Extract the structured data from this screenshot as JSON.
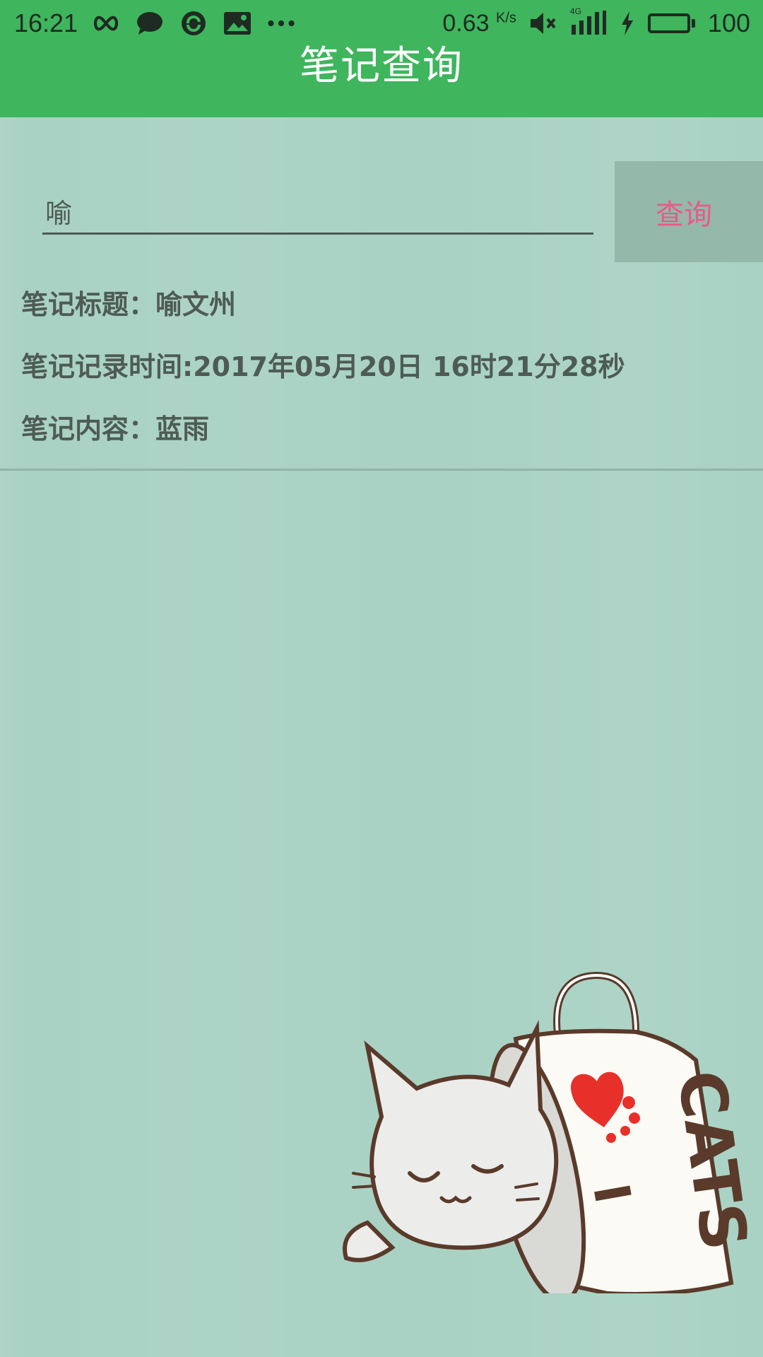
{
  "status_bar": {
    "time": "16:21",
    "network_speed": "0.63",
    "network_speed_unit": "K/s",
    "signal_label": "4G",
    "battery": "100"
  },
  "app_bar": {
    "title": "笔记查询",
    "color": "#3fb55d"
  },
  "search": {
    "input_value": "喻",
    "button_label": "查询",
    "button_color": "#e85a8b"
  },
  "result": {
    "title_line": "笔记标题：喻文州",
    "time_line": "笔记记录时间:2017年05月20日 16时21分28秒",
    "content_line": "笔记内容：蓝雨"
  },
  "illustration": {
    "mug_text_1": "I",
    "mug_text_2": "CATS"
  }
}
